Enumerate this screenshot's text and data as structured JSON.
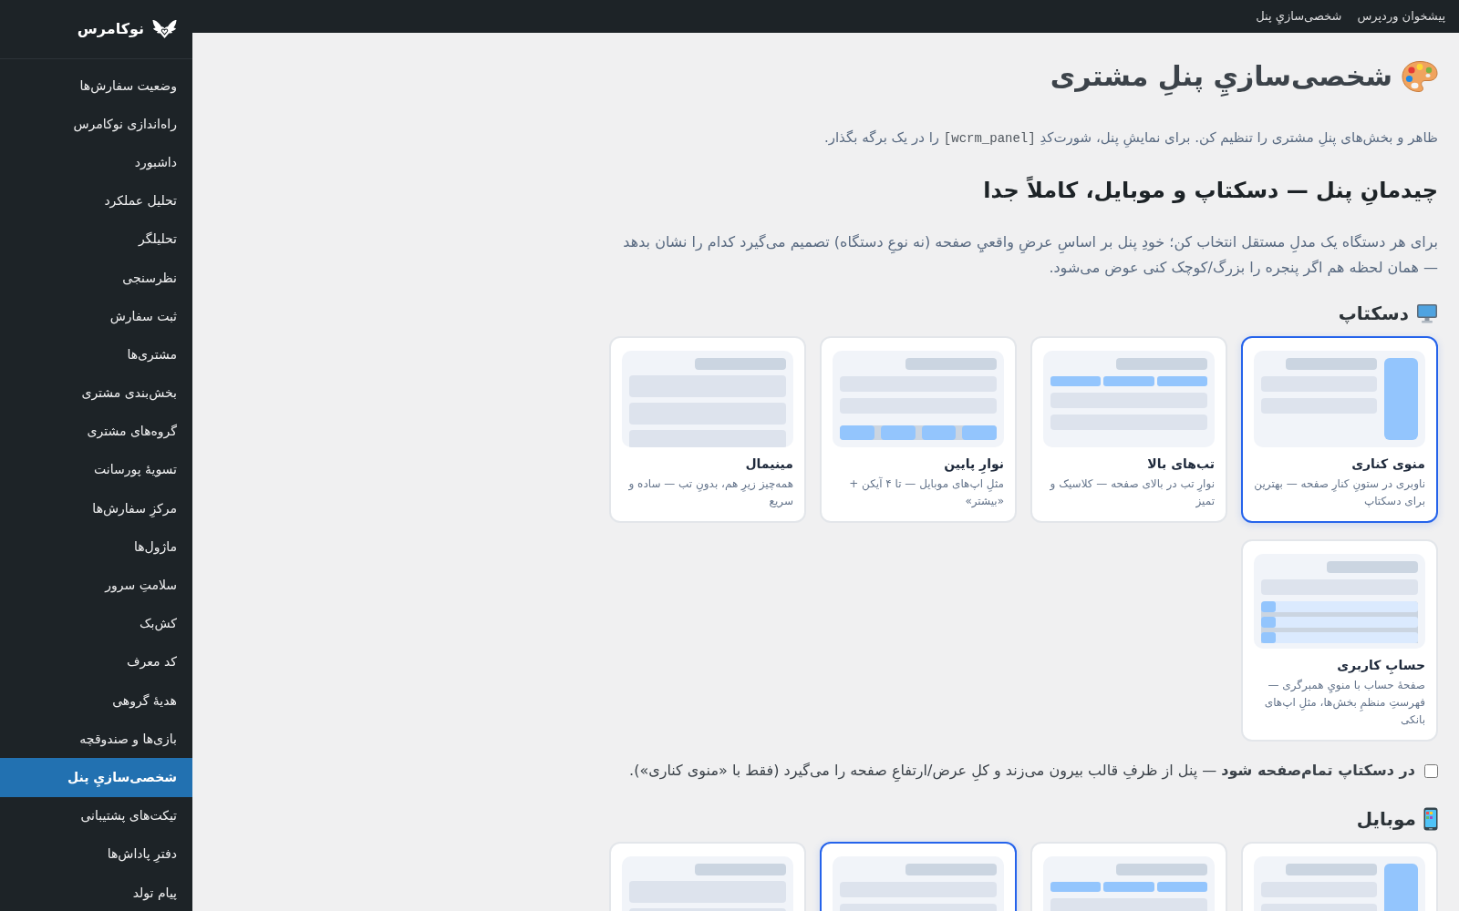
{
  "top_bar": {
    "links": [
      "پیشخوان وردپرس",
      "شخصی‌سازيِ پنل"
    ]
  },
  "sidebar": {
    "brand": "نوکامرس",
    "items": [
      {
        "label": "وضعیت سفارش‌ها",
        "selected": false
      },
      {
        "label": "راه‌اندازی نوکامرس",
        "selected": false
      },
      {
        "label": "داشبورد",
        "selected": false
      },
      {
        "label": "تحلیل عملکرد",
        "selected": false
      },
      {
        "label": "تحلیلگر",
        "selected": false
      },
      {
        "label": "نظرسنجی",
        "selected": false
      },
      {
        "label": "ثبت سفارش",
        "selected": false
      },
      {
        "label": "مشتری‌ها",
        "selected": false
      },
      {
        "label": "بخش‌بندی مشتری",
        "selected": false
      },
      {
        "label": "گروه‌های مشتری",
        "selected": false
      },
      {
        "label": "تسویهٔ پورسانت",
        "selected": false
      },
      {
        "label": "مرکزِ سفارش‌ها",
        "selected": false
      },
      {
        "label": "ماژول‌ها",
        "selected": false
      },
      {
        "label": "سلامتِ سرور",
        "selected": false
      },
      {
        "label": "کش‌بک",
        "selected": false
      },
      {
        "label": "کد معرف",
        "selected": false
      },
      {
        "label": "هدیهٔ گروهی",
        "selected": false
      },
      {
        "label": "بازی‌ها و صندوقچه",
        "selected": false
      },
      {
        "label": "شخصی‌سازيِ پنل",
        "selected": true
      },
      {
        "label": "تیکت‌های پشتیبانی",
        "selected": false
      },
      {
        "label": "دفترِ پاداش‌ها",
        "selected": false
      },
      {
        "label": "پیام تولد",
        "selected": false
      }
    ]
  },
  "page": {
    "title": "شخصی‌سازيِ پنلِ مشتری",
    "intro": {
      "before": "ظاهر و بخش‌های پنلِ مشتری را تنظیم کن. برای نمایشِ پنل، شورت‌کدِ",
      "code": "[wcrm_panel]",
      "after": "را در یک برگه بگذار."
    }
  },
  "layout": {
    "heading": "چیدمانِ پنل — دسکتاپ و موبایل، کاملاً جدا",
    "description": "برای هر دستگاه یک مدلِ مستقل انتخاب کن؛ خودِ پنل بر اساسِ عرضِ واقعيِ صفحه (نه نوعِ دستگاه) تصمیم می‌گیرد کدام را نشان بدهد — همان لحظه هم اگر پنجره را بزرگ/کوچک کنی عوض می‌شود.",
    "desktop": {
      "heading": "دسکتاپ",
      "options": [
        {
          "kind": "sidebar",
          "title": "منوی کناری",
          "description": "ناوبری در ستونِ کنارِ صفحه — بهترین برای دسکتاپ",
          "selected": true
        },
        {
          "kind": "tabs",
          "title": "تب‌های بالا",
          "description": "نوارِ تب در بالای صفحه — کلاسیک و تمیز",
          "selected": false
        },
        {
          "kind": "bottom_bar",
          "title": "نوارِ پایین",
          "description": "مثلِ اپ‌های موبایل — تا ۴ آیکن + «بیشتر»",
          "selected": false
        },
        {
          "kind": "minimal",
          "title": "مینیمال",
          "description": "همه‌چیز زیرِ هم، بدونِ تب — ساده و سریع",
          "selected": false
        },
        {
          "kind": "account",
          "title": "حسابِ کاربری",
          "description": "صفحهٔ حساب با منويِ همبرگری — فهرستِ منظمِ بخش‌ها، مثلِ اپ‌های بانکی",
          "selected": false
        }
      ]
    },
    "fullscreen": {
      "checked": false,
      "label": "**در دسکتاپ تمام‌صفحه شود** — پنل از ظرفِ قالب بیرون می‌زند و کلِ عرض/ارتفاعِ صفحه را می‌گیرد (فقط با «منوی کناری»)."
    },
    "mobile": {
      "heading": "موبایل",
      "options": [
        {
          "kind": "sidebar",
          "selected": false
        },
        {
          "kind": "tabs",
          "selected": false
        },
        {
          "kind": "bottom_bar",
          "selected": true
        },
        {
          "kind": "minimal",
          "selected": false
        }
      ]
    }
  }
}
